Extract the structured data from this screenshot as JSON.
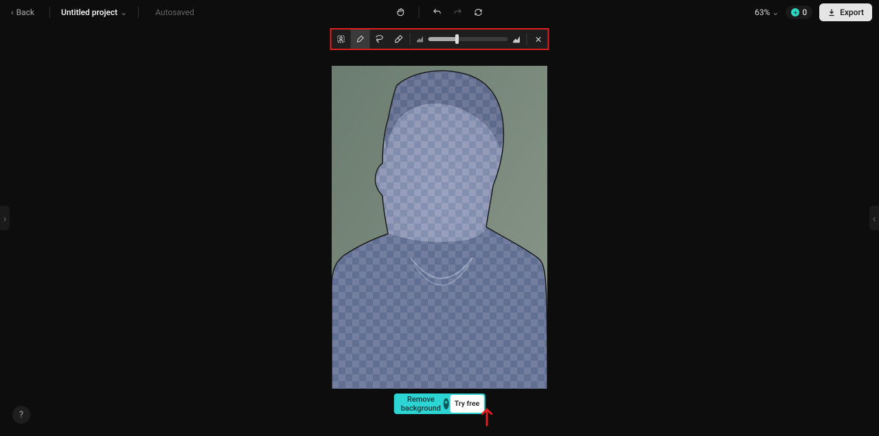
{
  "header": {
    "back_label": "Back",
    "project_name": "Untitled project",
    "autosave_label": "Autosaved",
    "zoom_level": "63%",
    "credits_count": "0",
    "export_label": "Export"
  },
  "toolbar": {
    "tools": [
      {
        "name": "portrait-select-tool",
        "active": false
      },
      {
        "name": "brush-tool",
        "active": true
      },
      {
        "name": "lasso-tool",
        "active": false
      },
      {
        "name": "eraser-tool",
        "active": false
      }
    ],
    "slider_value": 36,
    "close_label": "Close"
  },
  "cta": {
    "main_label": "Remove background",
    "try_label": "Try free"
  },
  "help_label": "?",
  "icons": {
    "chevron_left": "‹",
    "chevron_right": "›",
    "chevron_down": "⌄"
  }
}
